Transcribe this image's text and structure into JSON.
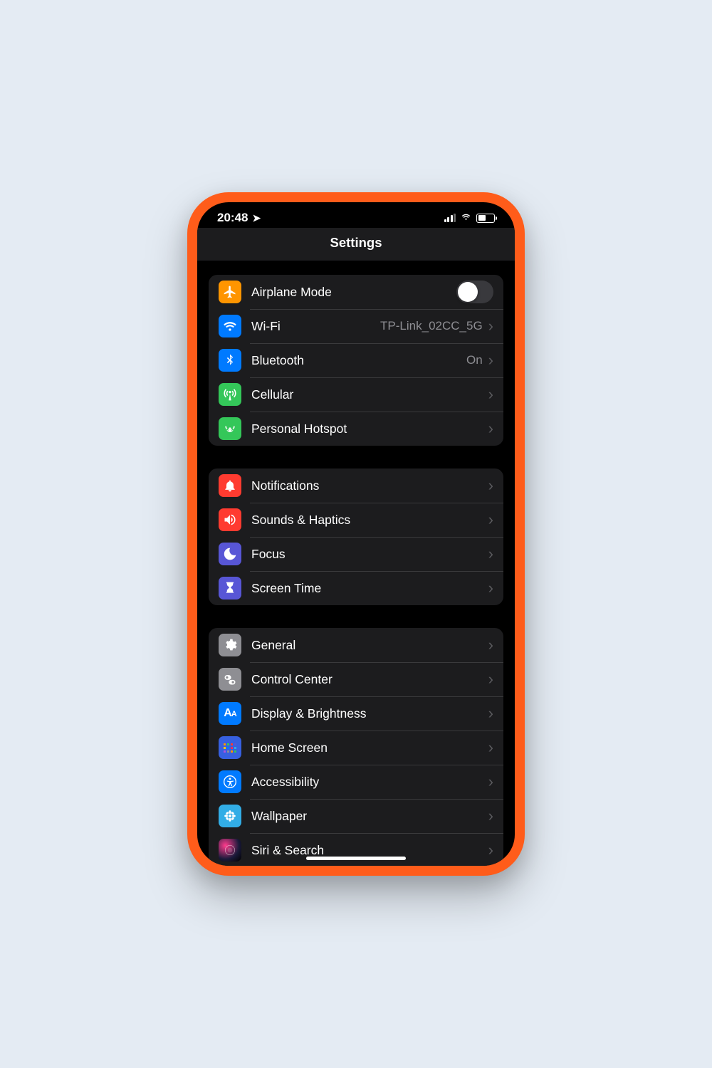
{
  "statusbar": {
    "time": "20:48"
  },
  "header": {
    "title": "Settings"
  },
  "groups": [
    {
      "rows": [
        {
          "id": "airplane",
          "label": "Airplane Mode",
          "icon": "airplane-icon",
          "color": "bg-orange",
          "toggle": false
        },
        {
          "id": "wifi",
          "label": "Wi-Fi",
          "value": "TP-Link_02CC_5G",
          "icon": "wifi-icon",
          "color": "bg-blue"
        },
        {
          "id": "bluetooth",
          "label": "Bluetooth",
          "value": "On",
          "icon": "bluetooth-icon",
          "color": "bg-blue"
        },
        {
          "id": "cellular",
          "label": "Cellular",
          "icon": "antenna-icon",
          "color": "bg-green"
        },
        {
          "id": "hotspot",
          "label": "Personal Hotspot",
          "icon": "hotspot-icon",
          "color": "bg-green"
        }
      ]
    },
    {
      "rows": [
        {
          "id": "notifications",
          "label": "Notifications",
          "icon": "bell-icon",
          "color": "bg-red"
        },
        {
          "id": "sounds",
          "label": "Sounds & Haptics",
          "icon": "speaker-icon",
          "color": "bg-red"
        },
        {
          "id": "focus",
          "label": "Focus",
          "icon": "moon-icon",
          "color": "bg-purple"
        },
        {
          "id": "screentime",
          "label": "Screen Time",
          "icon": "hourglass-icon",
          "color": "bg-purple"
        }
      ]
    },
    {
      "rows": [
        {
          "id": "general",
          "label": "General",
          "icon": "gear-icon",
          "color": "bg-gray"
        },
        {
          "id": "controlcenter",
          "label": "Control Center",
          "icon": "switches-icon",
          "color": "bg-gray"
        },
        {
          "id": "display",
          "label": "Display & Brightness",
          "icon": "text-size-icon",
          "color": "bg-blue"
        },
        {
          "id": "homescreen",
          "label": "Home Screen",
          "icon": "home-grid-icon",
          "color": "bg-darkblue"
        },
        {
          "id": "accessibility",
          "label": "Accessibility",
          "icon": "accessibility-icon",
          "color": "bg-blue"
        },
        {
          "id": "wallpaper",
          "label": "Wallpaper",
          "icon": "flower-icon",
          "color": "bg-cyan"
        },
        {
          "id": "siri",
          "label": "Siri & Search",
          "icon": "siri-icon",
          "color": "siri-bg"
        }
      ]
    }
  ]
}
